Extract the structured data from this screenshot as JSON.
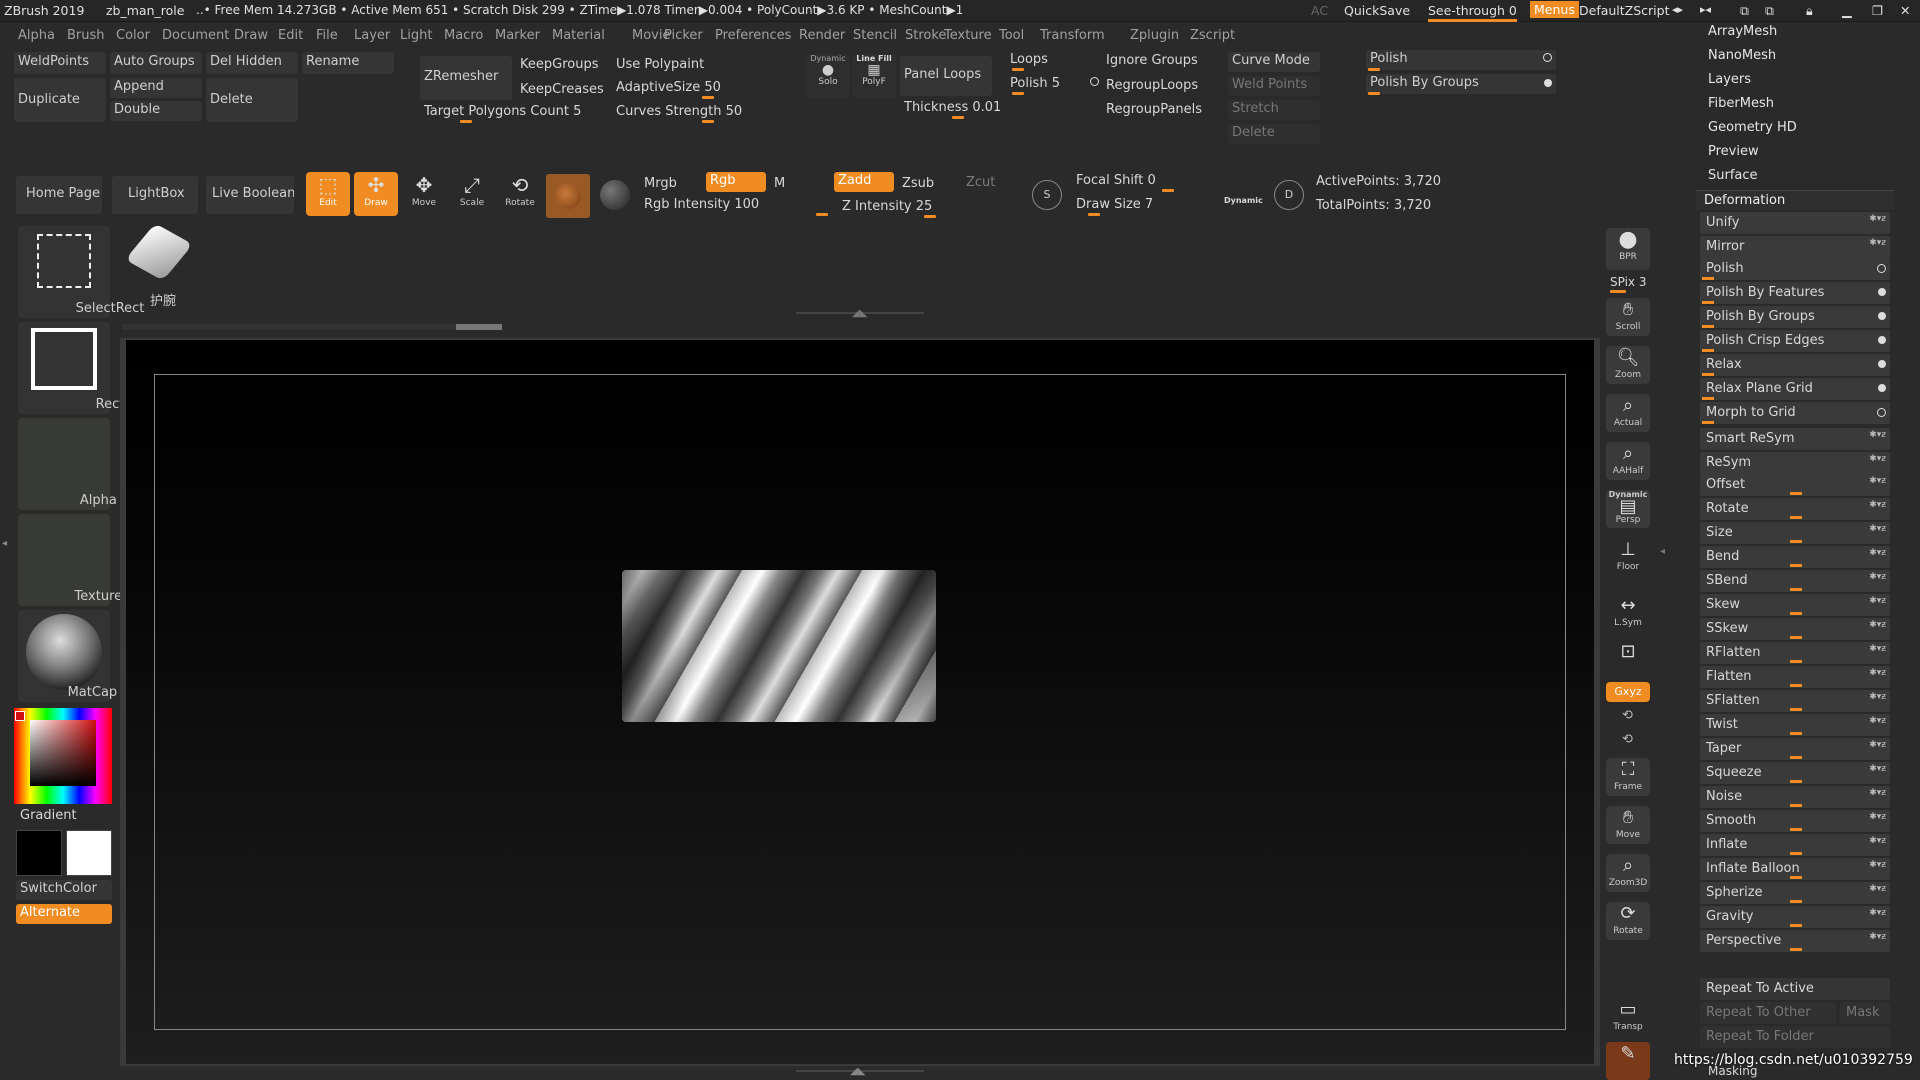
{
  "title_bar": {
    "app": "ZBrush 2019",
    "doc": "zb_man_role",
    "status": "..• Free Mem 14.273GB • Active Mem 651 • Scratch Disk 299 • ZTime▶1.078 Timer▶0.004 • PolyCount▶3.6 KP • MeshCount▶1",
    "ac": "AC",
    "quicksave": "QuickSave",
    "see_through": "See-through  0",
    "menus": "Menus",
    "script": "DefaultZScript"
  },
  "menu_bar": [
    "Alpha",
    "Brush",
    "Color",
    "Document",
    "Draw",
    "Edit",
    "File",
    "Layer",
    "Light",
    "Macro",
    "Marker",
    "Material",
    "Movie",
    "Picker",
    "Preferences",
    "Render",
    "Stencil",
    "Stroke",
    "Texture",
    "Tool",
    "Transform",
    "Zplugin",
    "Zscript"
  ],
  "subtool": {
    "weldpoints": "WeldPoints",
    "auto_groups": "Auto Groups",
    "del_hidden": "Del Hidden",
    "rename": "Rename",
    "duplicate": "Duplicate",
    "append": "Append",
    "delete": "Delete",
    "double": "Double"
  },
  "zremesher": {
    "button": "ZRemesher",
    "keepgroups": "KeepGroups",
    "keepcreases": "KeepCreases",
    "use_polypaint": "Use Polypaint",
    "adaptive_size": "AdaptiveSize 50",
    "target_polygons": "Target Polygons Count 5",
    "curves_strength": "Curves Strength 50"
  },
  "dynamic_solo": {
    "top": "Dynamic",
    "label": "Solo"
  },
  "linefill": {
    "top": "Line Fill",
    "label": "PolyF"
  },
  "panel_loops": {
    "button": "Panel Loops",
    "loops": "Loops",
    "polish": "Polish 5",
    "thickness": "Thickness 0.01",
    "ignore_groups": "Ignore Groups",
    "regroup_loops": "RegroupLoops",
    "regroup_panels": "RegroupPanels"
  },
  "curve": {
    "curve_mode": "Curve Mode",
    "weld_points": "Weld Points",
    "stretch": "Stretch",
    "delete": "Delete"
  },
  "polish_top": {
    "polish": "Polish",
    "polish_by_groups": "Polish By Groups"
  },
  "shelf": {
    "home_page": "Home Page",
    "lightbox": "LightBox",
    "live_boolean": "Live Boolean",
    "edit": "Edit",
    "draw": "Draw",
    "move": "Move",
    "scale": "Scale",
    "rotate": "Rotate",
    "mrgb": "Mrgb",
    "rgb": "Rgb",
    "m": "M",
    "rgb_intensity": "Rgb Intensity 100",
    "zadd": "Zadd",
    "zsub": "Zsub",
    "zcut": "Zcut",
    "z_intensity": "Z Intensity 25",
    "focal_shift": "Focal Shift 0",
    "draw_size": "Draw Size 7",
    "dynamic": "Dynamic",
    "active_points": "ActivePoints: 3,720",
    "total_points": "TotalPoints: 3,720"
  },
  "left_panel": {
    "select_rect": "SelectRect",
    "brush_name": "护腕",
    "rect": "Rect",
    "alpha_off": "Alpha Off",
    "texture_off": "Texture Off",
    "matcap": "MatCap Gray",
    "gradient": "Gradient",
    "switch_color": "SwitchColor",
    "alternate": "Alternate"
  },
  "right_shelf": {
    "bpr": "BPR",
    "spix": "SPix 3",
    "scroll": "Scroll",
    "zoom": "Zoom",
    "actual": "Actual",
    "aahalf": "AAHalf",
    "dynamic": "Dynamic",
    "persp": "Persp",
    "floor": "Floor",
    "lsym": "L.Sym",
    "xyz": "Gxyz",
    "frame": "Frame",
    "move": "Move",
    "zoom3d": "Zoom3D",
    "rotate": "Rotate",
    "transp": "Transp"
  },
  "tray": {
    "top_items": [
      "ArrayMesh",
      "NanoMesh",
      "Layers",
      "FiberMesh",
      "Geometry HD",
      "Preview",
      "Surface"
    ],
    "deformation": "Deformation",
    "items": [
      "Unify",
      "Mirror",
      "Polish",
      "Polish By Features",
      "Polish By Groups",
      "Polish Crisp Edges",
      "Relax",
      "Relax Plane Grid",
      "Morph to Grid",
      "Smart ReSym",
      "ReSym",
      "Offset",
      "Rotate",
      "Size",
      "Bend",
      "SBend",
      "Skew",
      "SSkew",
      "RFlatten",
      "Flatten",
      "SFlatten",
      "Twist",
      "Taper",
      "Squeeze",
      "Noise",
      "Smooth",
      "Inflate",
      "Inflate Balloon",
      "Spherize",
      "Gravity",
      "Perspective"
    ],
    "repeat_to_active": "Repeat To Active",
    "repeat_to_other": "Repeat To Other",
    "mask": "Mask",
    "repeat_to_folder": "Repeat To Folder",
    "masking": "Masking"
  },
  "watermark": "https://blog.csdn.net/u010392759",
  "colors": {
    "accent": "#f08c21",
    "bg": "#2a2a2a",
    "canvas": "#000000"
  }
}
